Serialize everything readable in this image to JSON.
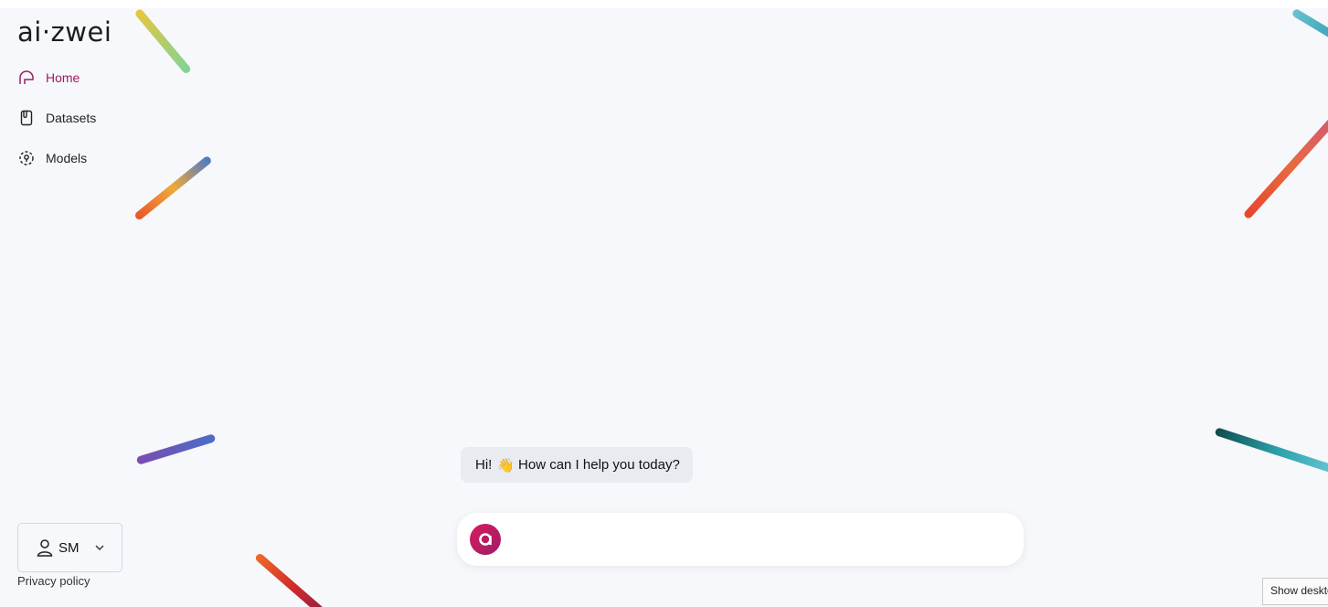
{
  "brand": {
    "logo_text": "ai·zwei"
  },
  "nav": {
    "items": [
      {
        "label": "Home",
        "icon": "home-icon",
        "active": true
      },
      {
        "label": "Datasets",
        "icon": "datasets-icon",
        "active": false
      },
      {
        "label": "Models",
        "icon": "models-icon",
        "active": false
      }
    ]
  },
  "user": {
    "initials": "SM"
  },
  "footer": {
    "privacy_label": "Privacy policy"
  },
  "chat": {
    "greeting_start": "Hi!",
    "greeting_emoji": "👋",
    "greeting_end": "How can I help you today?",
    "input_value": ""
  },
  "taskbar": {
    "tooltip": "Show desktop"
  },
  "colors": {
    "accent": "#9c1e64",
    "background": "#f6f8fb",
    "bubble": "#e8ebef"
  }
}
